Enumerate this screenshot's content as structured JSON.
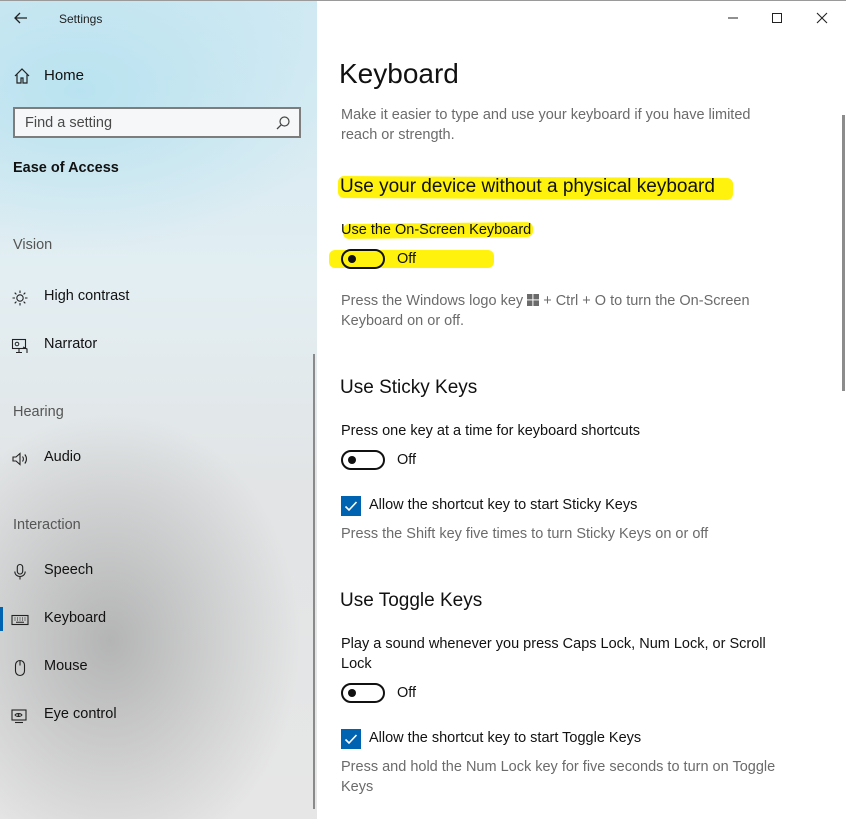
{
  "app": {
    "title": "Settings"
  },
  "sidebar": {
    "home_label": "Home",
    "search_placeholder": "Find a setting",
    "section_title": "Ease of Access",
    "groups": {
      "vision": "Vision",
      "hearing": "Hearing",
      "interaction": "Interaction"
    },
    "items": {
      "high_contrast": "High contrast",
      "narrator": "Narrator",
      "audio": "Audio",
      "speech": "Speech",
      "keyboard": "Keyboard",
      "mouse": "Mouse",
      "eye_control": "Eye control"
    },
    "active_item": "keyboard"
  },
  "main": {
    "title": "Keyboard",
    "intro": "Make it easier to type and use your keyboard if you have limited reach or strength.",
    "osk": {
      "heading": "Use your device without a physical keyboard",
      "label": "Use the On-Screen Keyboard",
      "state": "Off",
      "hint_before": "Press the Windows logo key",
      "hint_after": "+ Ctrl + O to turn the On-Screen Keyboard on or off."
    },
    "sticky": {
      "heading": "Use Sticky Keys",
      "label": "Press one key at a time for keyboard shortcuts",
      "state": "Off",
      "checkbox_label": "Allow the shortcut key to start Sticky Keys",
      "checkbox_checked": true,
      "hint": "Press the Shift key five times to turn Sticky Keys on or off"
    },
    "toggle": {
      "heading": "Use Toggle Keys",
      "label": "Play a sound whenever you press Caps Lock, Num Lock, or Scroll Lock",
      "state": "Off",
      "checkbox_label": "Allow the shortcut key to start Toggle Keys",
      "checkbox_checked": true,
      "hint": "Press and hold the Num Lock key for five seconds to turn on Toggle Keys"
    }
  },
  "colors": {
    "accent": "#0063b1",
    "highlight": "#fff200",
    "secondary_text": "#6b6b6b"
  }
}
